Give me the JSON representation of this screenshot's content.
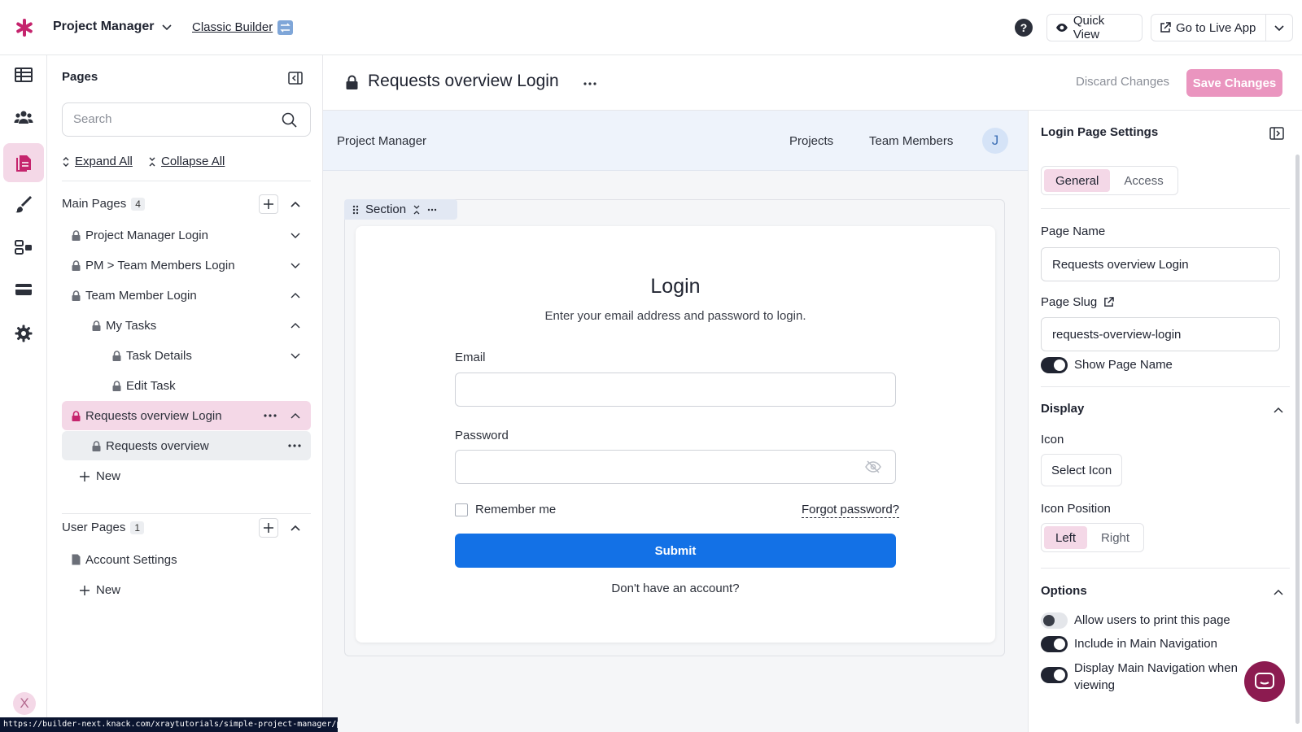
{
  "topbar": {
    "app_name": "Project Manager",
    "builder_label": "Classic Builder",
    "help_label": "?",
    "quick_view_label": "Quick View",
    "go_live_label": "Go to Live App"
  },
  "rail": {
    "icons": [
      "table-icon",
      "users-icon",
      "pages-icon",
      "brush-icon",
      "flows-icon",
      "card-icon",
      "gear-icon"
    ],
    "active": "pages-icon"
  },
  "pages_panel": {
    "title": "Pages",
    "search_placeholder": "Search",
    "expand_all": "Expand All",
    "collapse_all": "Collapse All",
    "main_pages": {
      "label": "Main Pages",
      "count": "4",
      "items": [
        {
          "label": "Project Manager Login"
        },
        {
          "label": "PM > Team Members Login"
        },
        {
          "label": "Team Member Login"
        },
        {
          "label": "My Tasks"
        },
        {
          "label": "Task Details"
        },
        {
          "label": "Edit Task"
        },
        {
          "label": "Requests overview Login"
        },
        {
          "label": "Requests overview"
        }
      ],
      "new_label": "New"
    },
    "user_pages": {
      "label": "User Pages",
      "count": "1",
      "items": [
        {
          "label": "Account Settings"
        }
      ],
      "new_label": "New"
    }
  },
  "main_header": {
    "page_title": "Requests overview Login",
    "discard_label": "Discard Changes",
    "save_label": "Save Changes"
  },
  "preview": {
    "nav_brand": "Project Manager",
    "nav_links": [
      "Projects",
      "Team Members"
    ],
    "avatar_initial": "J",
    "section_label": "Section",
    "login": {
      "title": "Login",
      "subtitle": "Enter your email address and password to login.",
      "email_label": "Email",
      "email_value": "",
      "password_label": "Password",
      "password_value": "",
      "remember_label": "Remember me",
      "remember_checked": false,
      "forgot_label": "Forgot password?",
      "submit_label": "Submit",
      "no_account_label": "Don't have an account?"
    }
  },
  "settings": {
    "title": "Login Page Settings",
    "tabs": [
      {
        "label": "General",
        "selected": true
      },
      {
        "label": "Access",
        "selected": false
      }
    ],
    "page_name_label": "Page Name",
    "page_name_value": "Requests overview Login",
    "page_slug_label": "Page Slug",
    "page_slug_value": "requests-overview-login",
    "show_page_name_label": "Show Page Name",
    "show_page_name": true,
    "display_header": "Display",
    "icon_label": "Icon",
    "select_icon_label": "Select Icon",
    "icon_position_label": "Icon Position",
    "icon_position_options": [
      {
        "label": "Left",
        "selected": true
      },
      {
        "label": "Right",
        "selected": false
      }
    ],
    "options_header": "Options",
    "options": [
      {
        "label": "Allow users to print this page",
        "on": false
      },
      {
        "label": "Include in Main Navigation",
        "on": true
      },
      {
        "label": "Display Main Navigation when viewing",
        "on": true
      }
    ]
  },
  "status_url": "https://builder-next.knack.com/xraytutorials/simple-project-manager/pages/scene_23",
  "colors": {
    "accent": "#c5246d",
    "accent_soft": "#f4d8e7",
    "primary_button": "#1371e6",
    "save_button": "#ea95bf"
  }
}
